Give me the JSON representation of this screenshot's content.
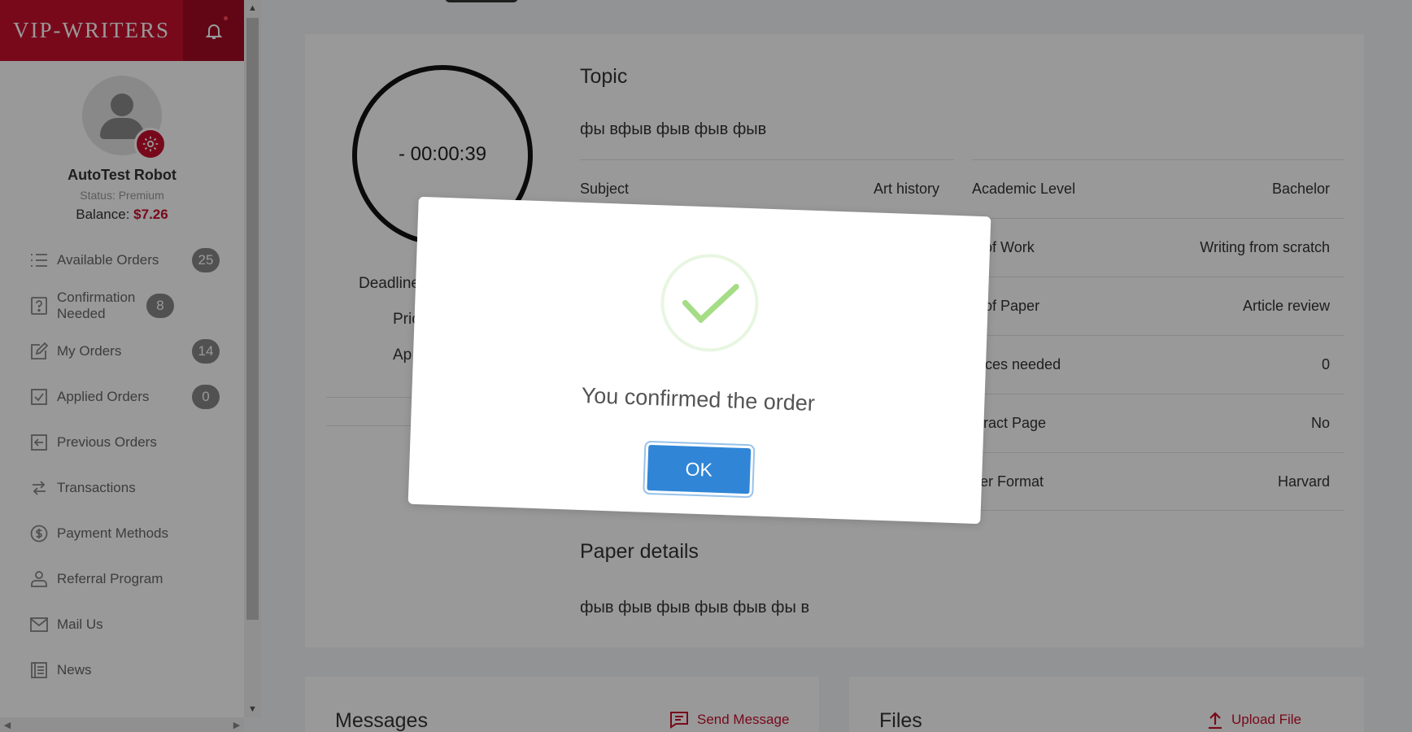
{
  "brand": {
    "logo_text": "VIP-WRITERS"
  },
  "profile": {
    "name": "AutoTest Robot",
    "status": "Status: Premium",
    "balance_label": "Balance:",
    "balance_amount": "$7.26"
  },
  "nav": [
    {
      "label": "Available Orders",
      "badge": "25",
      "icon": "list-icon"
    },
    {
      "label": "Confirmation Needed",
      "badge": "8",
      "icon": "question-icon"
    },
    {
      "label": "My Orders",
      "badge": "14",
      "icon": "edit-icon"
    },
    {
      "label": "Applied Orders",
      "badge": "0",
      "icon": "checkbox-icon"
    },
    {
      "label": "Previous Orders",
      "badge": "",
      "icon": "arrow-left-box-icon"
    },
    {
      "label": "Transactions",
      "badge": "",
      "icon": "transfer-icon"
    },
    {
      "label": "Payment Methods",
      "badge": "",
      "icon": "coin-icon"
    },
    {
      "label": "Referral Program",
      "badge": "",
      "icon": "referral-icon"
    },
    {
      "label": "Mail Us",
      "badge": "",
      "icon": "mail-icon"
    },
    {
      "label": "News",
      "badge": "",
      "icon": "news-icon"
    }
  ],
  "order": {
    "timer": "- 00:00:39",
    "left_labels": [
      "Deadline",
      "Pric",
      "Ap"
    ],
    "topic_title": "Topic",
    "topic_text": "фы вфыв фыв фыв фыв",
    "left_props": [
      {
        "k": "Subject",
        "v": "Art history"
      }
    ],
    "right_props": [
      {
        "k": "Academic Level",
        "v": "Bachelor"
      },
      {
        "k": "e of Work",
        "v": "Writing from scratch"
      },
      {
        "k": "e of Paper",
        "v": "Article review"
      },
      {
        "k": "urces needed",
        "v": "0"
      },
      {
        "k": "stract Page",
        "v": "No"
      },
      {
        "k": "per Format",
        "v": "Harvard"
      }
    ],
    "details_title": "Paper details",
    "details_text": "фыв фыв фыв фыв фыв фы в"
  },
  "messages": {
    "title": "Messages",
    "action": "Send Message"
  },
  "files": {
    "title": "Files",
    "action": "Upload File"
  },
  "modal": {
    "title": "You confirmed the order",
    "ok_label": "OK"
  },
  "colors": {
    "brand": "#c8102e",
    "brand_dark": "#a30b24",
    "ok_button": "#3085d6",
    "success": "#a5dc86"
  }
}
